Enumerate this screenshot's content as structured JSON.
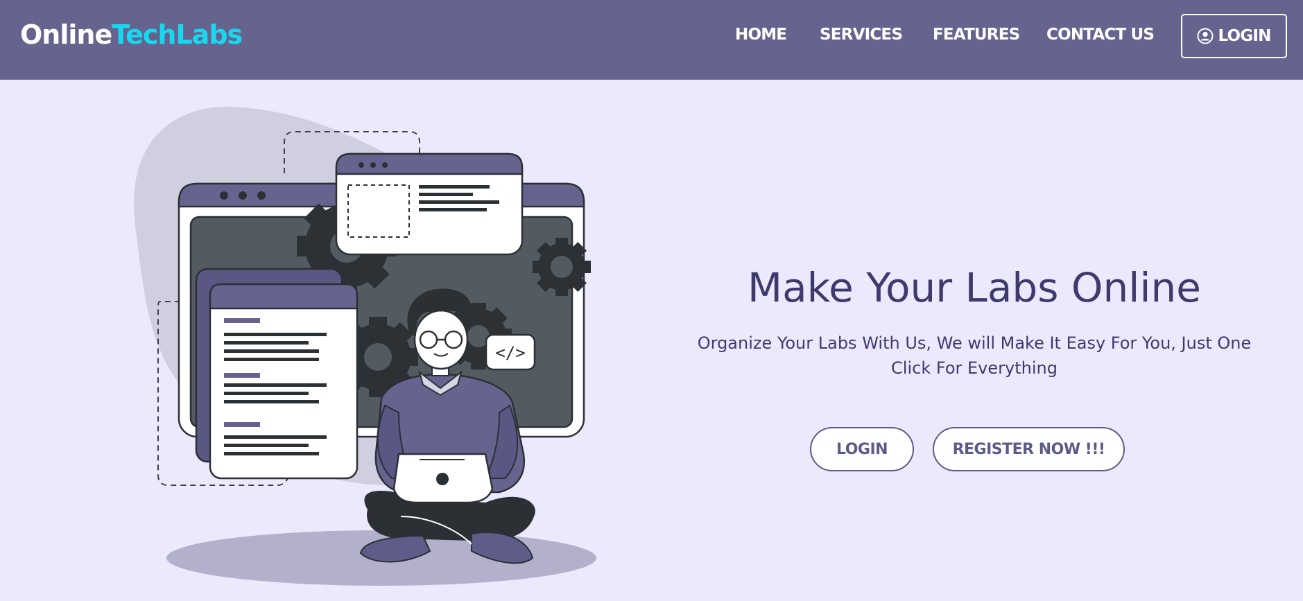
{
  "brand": {
    "name_part1": "Online",
    "name_part2": "TechLabs"
  },
  "nav": {
    "links": [
      "HOME",
      "SERVICES",
      "FEATURES",
      "CONTACT US"
    ],
    "login_label": "LOGIN",
    "login_icon": "user-circle-icon"
  },
  "hero": {
    "title": "Make Your Labs Online",
    "subtitle": "Organize Your Labs With Us, We will Make It Easy For You, Just One Click For Everything",
    "buttons": {
      "login": "LOGIN",
      "register": "REGISTER NOW !!!"
    }
  },
  "illustration": {
    "code_tag": "</>"
  },
  "colors": {
    "navbar_bg": "#66648f",
    "page_bg": "#ece9fd",
    "brand_accent": "#18d8ef",
    "title_text": "#3e3b6c",
    "button_border": "#5c5a86"
  }
}
